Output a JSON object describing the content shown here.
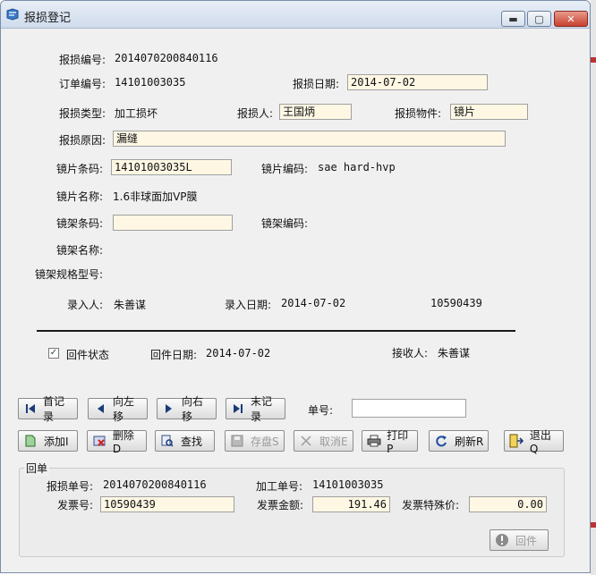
{
  "window": {
    "title": "报损登记",
    "min_glyph": "▬",
    "max_glyph": "▢",
    "close_glyph": "✕"
  },
  "form": {
    "report_no_label": "报损编号:",
    "report_no": "2014070200840116",
    "order_no_label": "订单编号:",
    "order_no": "14101003035",
    "report_date_label": "报损日期:",
    "report_date": "2014-07-02",
    "type_label": "报损类型:",
    "type": "加工损坏",
    "reporter_label": "报损人:",
    "reporter": "王国炳",
    "item_label": "报损物件:",
    "item": "镜片",
    "reason_label": "报损原因:",
    "reason": "漏缝",
    "lens_barcode_label": "镜片条码:",
    "lens_barcode": "14101003035L",
    "lens_code_label": "镜片编码:",
    "lens_code": "sae hard-hvp",
    "lens_name_label": "镜片名称:",
    "lens_name": "1.6非球面加VP膜",
    "frame_barcode_label": "镜架条码:",
    "frame_barcode": "",
    "frame_code_label": "镜架编码:",
    "frame_name_label": "镜架名称:",
    "frame_spec_label": "镜架规格型号:",
    "entered_by_label": "录入人:",
    "entered_by": "朱善谋",
    "entry_date_label": "录入日期:",
    "entry_date": "2014-07-02",
    "entry_number": "10590439"
  },
  "return_status": {
    "checkbox_label": "回件状态",
    "checked": true,
    "check_glyph": "✓",
    "return_date_label": "回件日期:",
    "return_date": "2014-07-02",
    "receiver_label": "接收人:",
    "receiver": "朱善谋"
  },
  "toolbar": {
    "first_label": "首记录",
    "left_label": "向左移",
    "right_label": "向右移",
    "last_label": "末记录",
    "doc_no_label": "单号:",
    "doc_no_value": "",
    "add_label": "添加I",
    "delete_label": "删除D",
    "search_label": "查找",
    "save_label": "存盘S",
    "cancel_label": "取消E",
    "print_label": "打印P",
    "refresh_label": "刷新R",
    "exit_label": "退出Q"
  },
  "receipt": {
    "section_label": "回单",
    "report_no_label": "报损单号:",
    "report_no": "2014070200840116",
    "process_no_label": "加工单号:",
    "process_no": "14101003035",
    "invoice_label": "发票号:",
    "invoice": "10590439",
    "amount_label": "发票金额:",
    "amount": "191.46",
    "special_label": "发票特殊价:",
    "special": "0.00",
    "return_button_label": "回件"
  }
}
